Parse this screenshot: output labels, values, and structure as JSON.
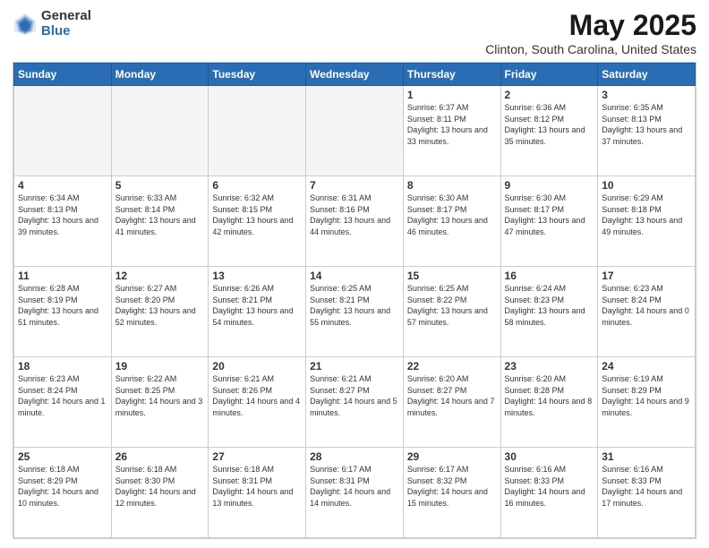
{
  "logo": {
    "general": "General",
    "blue": "Blue"
  },
  "header": {
    "title": "May 2025",
    "subtitle": "Clinton, South Carolina, United States"
  },
  "days_of_week": [
    "Sunday",
    "Monday",
    "Tuesday",
    "Wednesday",
    "Thursday",
    "Friday",
    "Saturday"
  ],
  "weeks": [
    [
      {
        "day": "",
        "info": ""
      },
      {
        "day": "",
        "info": ""
      },
      {
        "day": "",
        "info": ""
      },
      {
        "day": "",
        "info": ""
      },
      {
        "day": "1",
        "info": "Sunrise: 6:37 AM\nSunset: 8:11 PM\nDaylight: 13 hours\nand 33 minutes."
      },
      {
        "day": "2",
        "info": "Sunrise: 6:36 AM\nSunset: 8:12 PM\nDaylight: 13 hours\nand 35 minutes."
      },
      {
        "day": "3",
        "info": "Sunrise: 6:35 AM\nSunset: 8:13 PM\nDaylight: 13 hours\nand 37 minutes."
      }
    ],
    [
      {
        "day": "4",
        "info": "Sunrise: 6:34 AM\nSunset: 8:13 PM\nDaylight: 13 hours\nand 39 minutes."
      },
      {
        "day": "5",
        "info": "Sunrise: 6:33 AM\nSunset: 8:14 PM\nDaylight: 13 hours\nand 41 minutes."
      },
      {
        "day": "6",
        "info": "Sunrise: 6:32 AM\nSunset: 8:15 PM\nDaylight: 13 hours\nand 42 minutes."
      },
      {
        "day": "7",
        "info": "Sunrise: 6:31 AM\nSunset: 8:16 PM\nDaylight: 13 hours\nand 44 minutes."
      },
      {
        "day": "8",
        "info": "Sunrise: 6:30 AM\nSunset: 8:17 PM\nDaylight: 13 hours\nand 46 minutes."
      },
      {
        "day": "9",
        "info": "Sunrise: 6:30 AM\nSunset: 8:17 PM\nDaylight: 13 hours\nand 47 minutes."
      },
      {
        "day": "10",
        "info": "Sunrise: 6:29 AM\nSunset: 8:18 PM\nDaylight: 13 hours\nand 49 minutes."
      }
    ],
    [
      {
        "day": "11",
        "info": "Sunrise: 6:28 AM\nSunset: 8:19 PM\nDaylight: 13 hours\nand 51 minutes."
      },
      {
        "day": "12",
        "info": "Sunrise: 6:27 AM\nSunset: 8:20 PM\nDaylight: 13 hours\nand 52 minutes."
      },
      {
        "day": "13",
        "info": "Sunrise: 6:26 AM\nSunset: 8:21 PM\nDaylight: 13 hours\nand 54 minutes."
      },
      {
        "day": "14",
        "info": "Sunrise: 6:25 AM\nSunset: 8:21 PM\nDaylight: 13 hours\nand 55 minutes."
      },
      {
        "day": "15",
        "info": "Sunrise: 6:25 AM\nSunset: 8:22 PM\nDaylight: 13 hours\nand 57 minutes."
      },
      {
        "day": "16",
        "info": "Sunrise: 6:24 AM\nSunset: 8:23 PM\nDaylight: 13 hours\nand 58 minutes."
      },
      {
        "day": "17",
        "info": "Sunrise: 6:23 AM\nSunset: 8:24 PM\nDaylight: 14 hours\nand 0 minutes."
      }
    ],
    [
      {
        "day": "18",
        "info": "Sunrise: 6:23 AM\nSunset: 8:24 PM\nDaylight: 14 hours\nand 1 minute."
      },
      {
        "day": "19",
        "info": "Sunrise: 6:22 AM\nSunset: 8:25 PM\nDaylight: 14 hours\nand 3 minutes."
      },
      {
        "day": "20",
        "info": "Sunrise: 6:21 AM\nSunset: 8:26 PM\nDaylight: 14 hours\nand 4 minutes."
      },
      {
        "day": "21",
        "info": "Sunrise: 6:21 AM\nSunset: 8:27 PM\nDaylight: 14 hours\nand 5 minutes."
      },
      {
        "day": "22",
        "info": "Sunrise: 6:20 AM\nSunset: 8:27 PM\nDaylight: 14 hours\nand 7 minutes."
      },
      {
        "day": "23",
        "info": "Sunrise: 6:20 AM\nSunset: 8:28 PM\nDaylight: 14 hours\nand 8 minutes."
      },
      {
        "day": "24",
        "info": "Sunrise: 6:19 AM\nSunset: 8:29 PM\nDaylight: 14 hours\nand 9 minutes."
      }
    ],
    [
      {
        "day": "25",
        "info": "Sunrise: 6:18 AM\nSunset: 8:29 PM\nDaylight: 14 hours\nand 10 minutes."
      },
      {
        "day": "26",
        "info": "Sunrise: 6:18 AM\nSunset: 8:30 PM\nDaylight: 14 hours\nand 12 minutes."
      },
      {
        "day": "27",
        "info": "Sunrise: 6:18 AM\nSunset: 8:31 PM\nDaylight: 14 hours\nand 13 minutes."
      },
      {
        "day": "28",
        "info": "Sunrise: 6:17 AM\nSunset: 8:31 PM\nDaylight: 14 hours\nand 14 minutes."
      },
      {
        "day": "29",
        "info": "Sunrise: 6:17 AM\nSunset: 8:32 PM\nDaylight: 14 hours\nand 15 minutes."
      },
      {
        "day": "30",
        "info": "Sunrise: 6:16 AM\nSunset: 8:33 PM\nDaylight: 14 hours\nand 16 minutes."
      },
      {
        "day": "31",
        "info": "Sunrise: 6:16 AM\nSunset: 8:33 PM\nDaylight: 14 hours\nand 17 minutes."
      }
    ]
  ]
}
